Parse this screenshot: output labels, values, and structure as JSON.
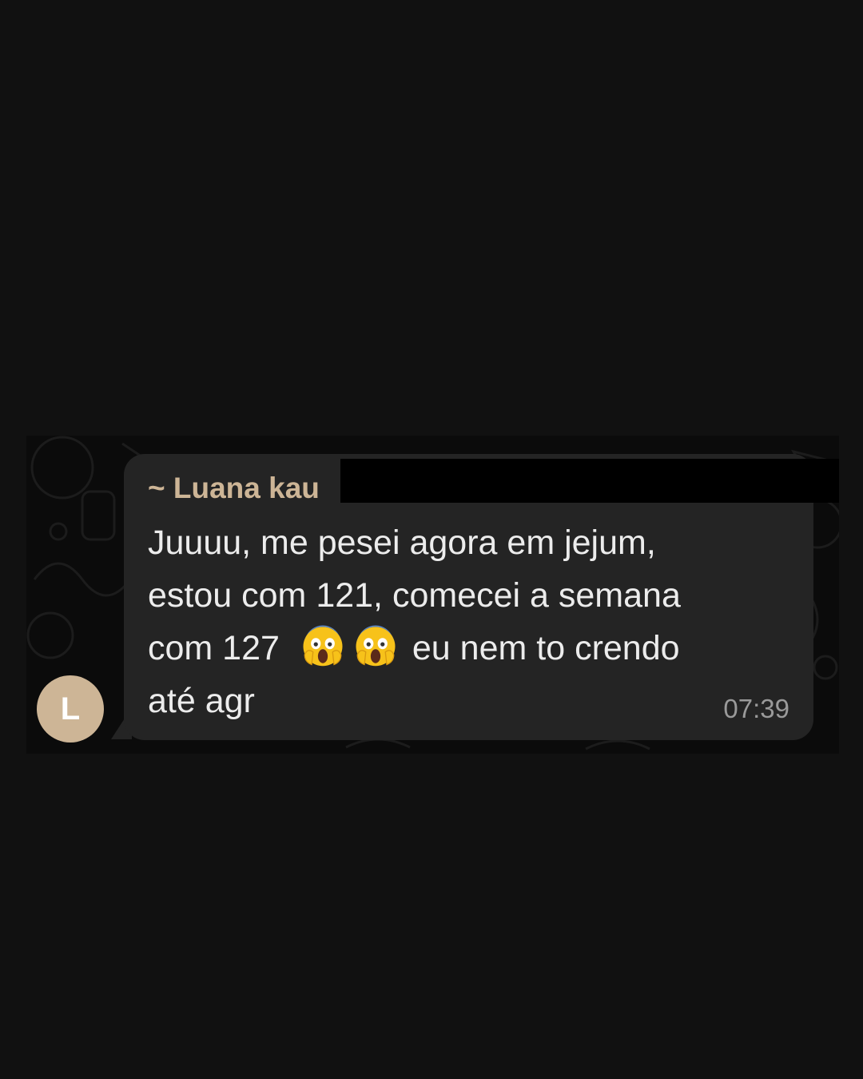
{
  "chat": {
    "avatar_initial": "L",
    "sender_name": "~ Luana kau",
    "message_lines": [
      "Juuuu, me pesei agora em jejum,",
      "estou com 121, comecei a semana",
      "com 127",
      "eu nem to crendo",
      "até agr"
    ],
    "emoji_name": "face-screaming-in-fear-icon",
    "timestamp": "07:39",
    "colors": {
      "page_background": "#111111",
      "bubble": "#242424",
      "sender_name": "#cdb596",
      "avatar": "#cdb596",
      "message_text": "#ececec",
      "timestamp": "#9a9a9a",
      "redaction": "#000000"
    }
  }
}
